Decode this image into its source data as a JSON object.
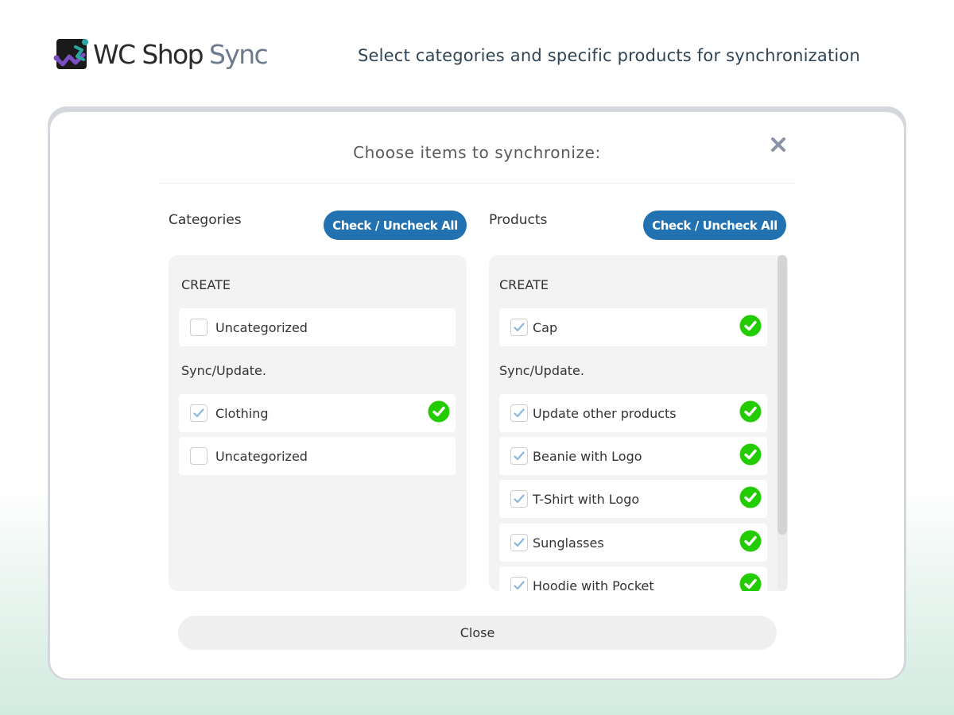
{
  "header": {
    "logo_text_main": "WC Shop",
    "logo_text_accent": "Sync",
    "tagline": "Select categories and specific products for synchronization"
  },
  "modal": {
    "title": "Choose items to synchronize:",
    "close_icon": "close-x-icon",
    "close_button_label": "Close"
  },
  "categories": {
    "label": "Categories",
    "check_all_label": "Check / Uncheck All",
    "groups": [
      {
        "label": "CREATE",
        "items": [
          {
            "label": "Uncategorized",
            "checked": false,
            "synced": false
          }
        ]
      },
      {
        "label": "Sync/Update.",
        "items": [
          {
            "label": "Clothing",
            "checked": true,
            "synced": true
          },
          {
            "label": "Uncategorized",
            "checked": false,
            "synced": false
          }
        ]
      }
    ]
  },
  "products": {
    "label": "Products",
    "check_all_label": "Check / Uncheck All",
    "groups": [
      {
        "label": "CREATE",
        "items": [
          {
            "label": "Cap",
            "checked": true,
            "synced": true
          }
        ]
      },
      {
        "label": "Sync/Update.",
        "items": [
          {
            "label": "Update other products",
            "checked": true,
            "synced": true
          },
          {
            "label": "Beanie with Logo",
            "checked": true,
            "synced": true
          },
          {
            "label": "T-Shirt with Logo",
            "checked": true,
            "synced": true
          },
          {
            "label": "Sunglasses",
            "checked": true,
            "synced": true
          },
          {
            "label": "Hoodie with Pocket",
            "checked": true,
            "synced": true
          }
        ]
      }
    ]
  },
  "colors": {
    "primary_button": "#2271b1",
    "success": "#22cc00",
    "checkbox_tick": "#8ab8e0"
  }
}
